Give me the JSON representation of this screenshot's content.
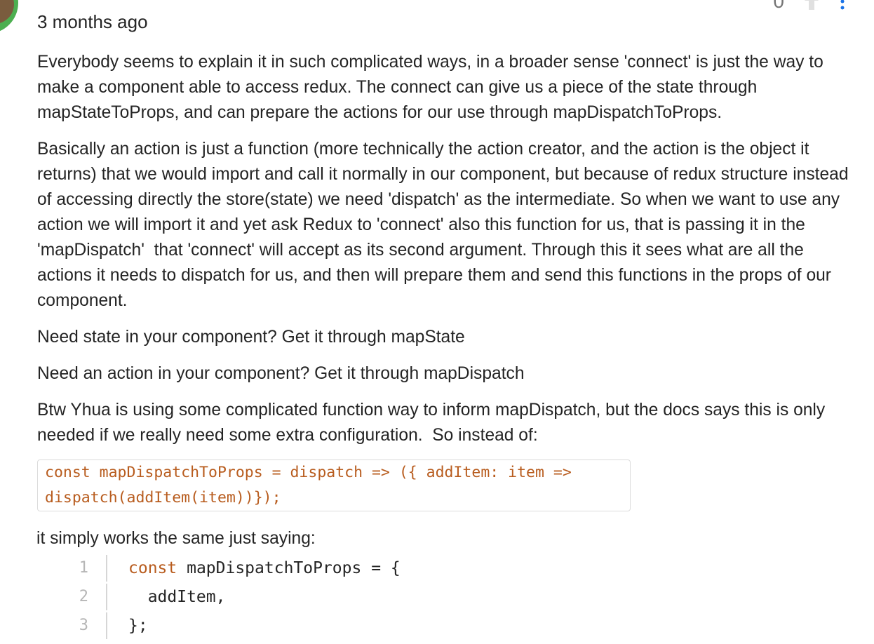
{
  "comment": {
    "timestamp": "3 months ago",
    "vote_count": "0",
    "paragraphs": [
      "Everybody seems to explain it in such complicated ways, in a broader sense 'connect' is just the way to make a component able to access redux. The connect can give us a piece of the state through mapStateToProps, and can prepare the actions for our use through mapDispatchToProps.",
      "Basically an action is just a function (more technically the action creator, and the action is the object it returns) that we would import and call it normally in our component, but because of redux structure instead of accessing directly the store(state) we need 'dispatch' as the intermediate. So when we want to use any action we will import it and yet ask Redux to 'connect' also this function for us, that is passing it in the 'mapDispatch'  that 'connect' will accept as its second argument. Through this it sees what are all the actions it needs to dispatch for us, and then will prepare them and send this functions in the props of our component.",
      "Need state in your component? Get it through mapState",
      "Need an action in your component? Get it through mapDispatch",
      "Btw Yhua is using some complicated function way to inform mapDispatch, but the docs says this is only needed if we really need some extra configuration.  So instead of:"
    ],
    "inline_code": "const mapDispatchToProps = dispatch => ({ addItem: item => dispatch(addItem(item))});",
    "intro_text": "it simply works the same just saying:",
    "code_block": {
      "lines": [
        {
          "number": "1",
          "keyword": "const",
          "text": " mapDispatchToProps = {"
        },
        {
          "number": "2",
          "keyword": "",
          "text": "  addItem,"
        },
        {
          "number": "3",
          "keyword": "",
          "text": "};"
        }
      ]
    },
    "colors": {
      "text": "#242424",
      "code_accent": "#b85c1e",
      "avatar_ring": "#4caf50",
      "muted": "#757575"
    },
    "icons": [
      "avatar",
      "upvote-icon",
      "more-icon"
    ]
  }
}
